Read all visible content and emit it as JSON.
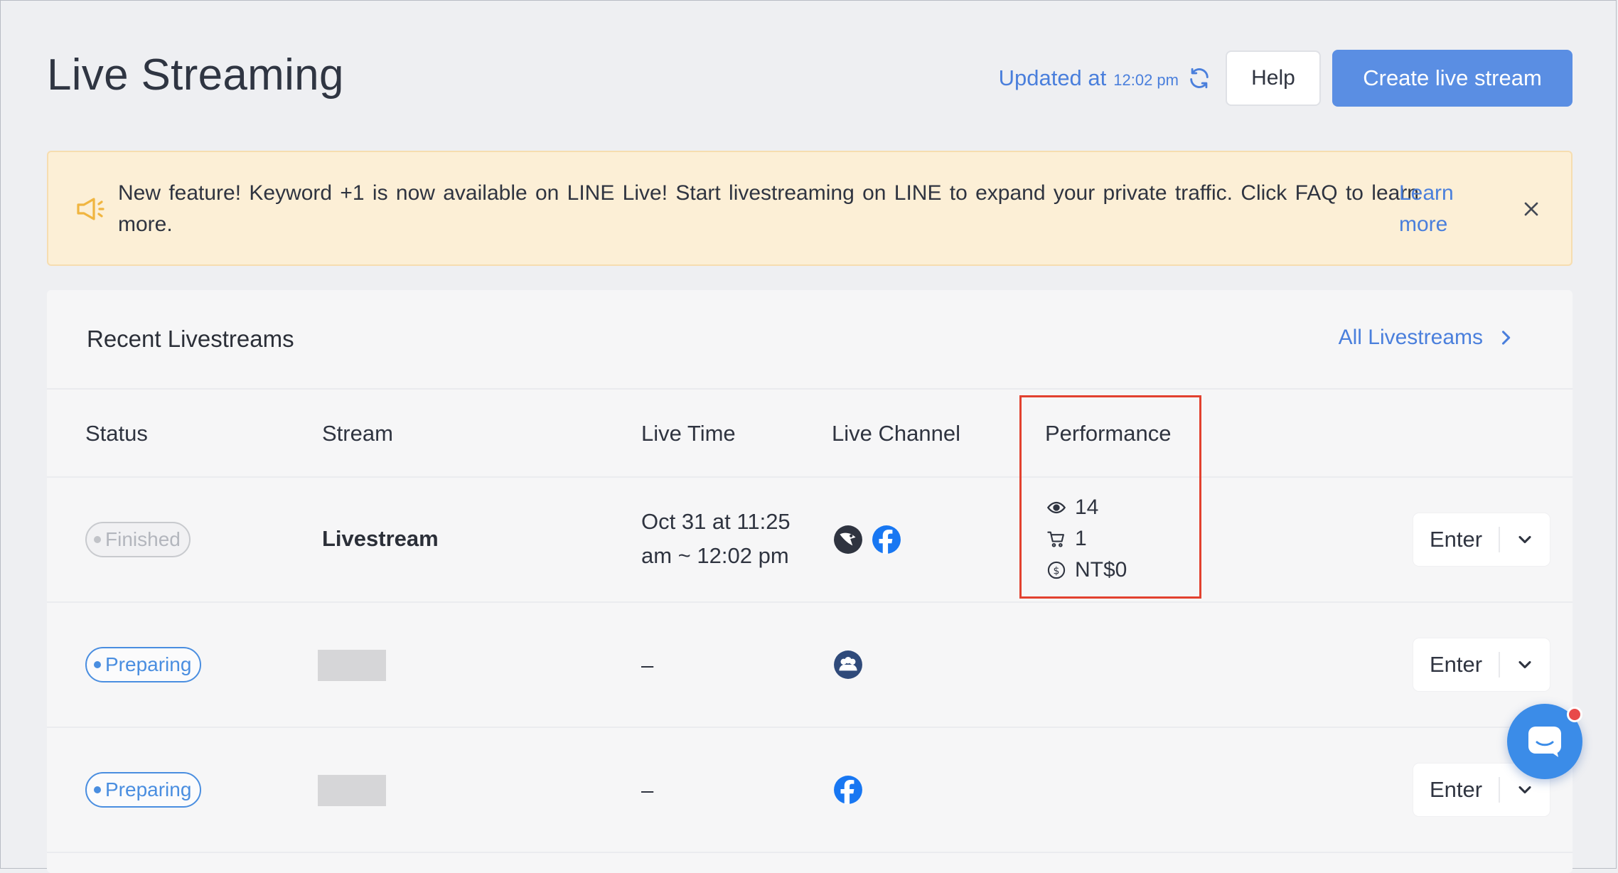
{
  "header": {
    "title": "Live Streaming",
    "updated_label": "Updated at",
    "updated_time": "12:02 pm",
    "help_label": "Help",
    "create_label": "Create live stream"
  },
  "banner": {
    "text": "New feature! Keyword +1 is now available on LINE Live! Start livestreaming on LINE to expand your private traffic. Click FAQ to learn more.",
    "link": "Learn more"
  },
  "recent": {
    "title": "Recent Livestreams",
    "all_link": "All Livestreams",
    "columns": [
      "Status",
      "Stream",
      "Live Time",
      "Live Channel",
      "Performance"
    ],
    "rows": [
      {
        "status": "Finished",
        "stream": "Livestream",
        "live_time": "Oct 31 at 11:25 am ~ 12:02 pm",
        "channels": [
          "line-live-icon",
          "facebook-icon"
        ],
        "performance": {
          "views": "14",
          "orders": "1",
          "revenue": "NT$0"
        },
        "enter": "Enter"
      },
      {
        "status": "Preparing",
        "stream": "",
        "live_time": "–",
        "channels": [
          "group-icon"
        ],
        "enter": "Enter"
      },
      {
        "status": "Preparing",
        "stream": "",
        "live_time": "–",
        "channels": [
          "facebook-icon"
        ],
        "enter": "Enter"
      }
    ]
  },
  "colors": {
    "accent": "#5a8ee3",
    "link": "#4a7fdc",
    "banner_bg": "#fcefd6",
    "highlight": "#e2412f",
    "chat": "#3b8ce8"
  }
}
